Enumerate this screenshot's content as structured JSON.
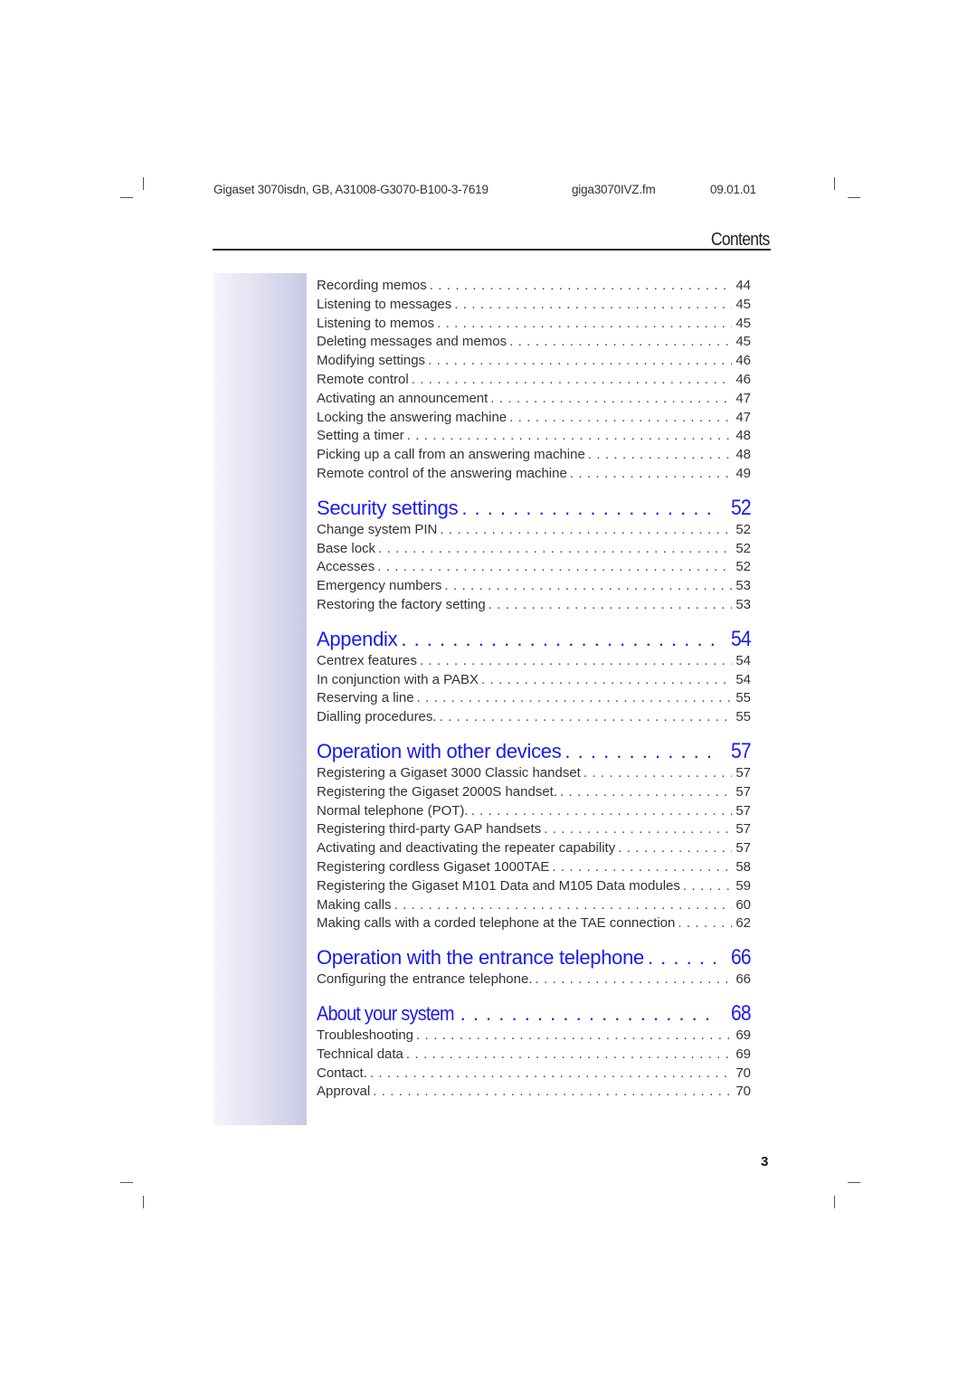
{
  "header": {
    "doc_id": "Gigaset 3070isdn, GB, A31008-G3070-B100-3-7619",
    "file_name": "giga3070IVZ.fm",
    "date": "09.01.01"
  },
  "title": "Contents",
  "toc": [
    {
      "type": "entry",
      "label": "Recording memos",
      "page": "44"
    },
    {
      "type": "entry",
      "label": "Listening to messages",
      "page": "45"
    },
    {
      "type": "entry",
      "label": "Listening to memos",
      "page": "45"
    },
    {
      "type": "entry",
      "label": "Deleting messages and memos",
      "page": "45"
    },
    {
      "type": "entry",
      "label": "Modifying settings",
      "page": "46"
    },
    {
      "type": "entry",
      "label": "Remote control",
      "page": "46"
    },
    {
      "type": "entry",
      "label": "Activating an announcement",
      "page": "47"
    },
    {
      "type": "entry",
      "label": "Locking the answering machine",
      "page": "47"
    },
    {
      "type": "entry",
      "label": "Setting a timer",
      "page": "48"
    },
    {
      "type": "entry",
      "label": "Picking up a call from an answering machine",
      "page": "48"
    },
    {
      "type": "entry",
      "label": "Remote control of the answering machine",
      "page": "49"
    },
    {
      "type": "section",
      "label": "Security settings",
      "page": "52"
    },
    {
      "type": "entry",
      "label": "Change system PIN",
      "page": "52"
    },
    {
      "type": "entry",
      "label": "Base lock",
      "page": "52"
    },
    {
      "type": "entry",
      "label": "Accesses",
      "page": "52"
    },
    {
      "type": "entry",
      "label": "Emergency numbers",
      "page": "53"
    },
    {
      "type": "entry",
      "label": "Restoring the factory setting",
      "page": "53"
    },
    {
      "type": "section",
      "label": "Appendix",
      "page": "54"
    },
    {
      "type": "entry",
      "label": "Centrex features",
      "page": "54"
    },
    {
      "type": "entry",
      "label": "In conjunction with a PABX",
      "page": "54"
    },
    {
      "type": "entry",
      "label": "Reserving a line",
      "page": "55"
    },
    {
      "type": "entry",
      "label": "Dialling procedures.",
      "page": "55"
    },
    {
      "type": "section",
      "label": "Operation with other devices",
      "page": "57"
    },
    {
      "type": "entry",
      "label": "Registering a Gigaset 3000 Classic handset",
      "page": "57"
    },
    {
      "type": "entry",
      "label": "Registering the Gigaset 2000S handset.",
      "page": "57"
    },
    {
      "type": "entry",
      "label": "Normal telephone (POT).",
      "page": "57"
    },
    {
      "type": "entry",
      "label": "Registering third-party GAP handsets",
      "page": "57"
    },
    {
      "type": "entry",
      "label": "Activating and deactivating the repeater capability",
      "page": "57"
    },
    {
      "type": "entry",
      "label": "Registering cordless Gigaset 1000TAE",
      "page": "58"
    },
    {
      "type": "entry",
      "label": "Registering the Gigaset M101 Data and M105 Data modules",
      "page": "59"
    },
    {
      "type": "entry",
      "label": "Making calls",
      "page": "60"
    },
    {
      "type": "entry",
      "label": "Making calls with a corded telephone at the TAE connection",
      "page": "62"
    },
    {
      "type": "section",
      "label": "Operation with the entrance telephone",
      "page": "66"
    },
    {
      "type": "entry",
      "label": "Configuring the entrance telephone.",
      "page": "66"
    },
    {
      "type": "section",
      "label": "About your system",
      "page": "68",
      "condensed": true
    },
    {
      "type": "entry",
      "label": "Troubleshooting",
      "page": "69"
    },
    {
      "type": "entry",
      "label": "Technical data",
      "page": "69"
    },
    {
      "type": "entry",
      "label": "Contact.",
      "page": "70"
    },
    {
      "type": "entry",
      "label": "Approval",
      "page": "70"
    }
  ],
  "page_number": "3",
  "colors": {
    "section_heading": "#1a1aee",
    "body_text": "#333333",
    "sidebar_gradient_end": "#c9c9e6"
  }
}
